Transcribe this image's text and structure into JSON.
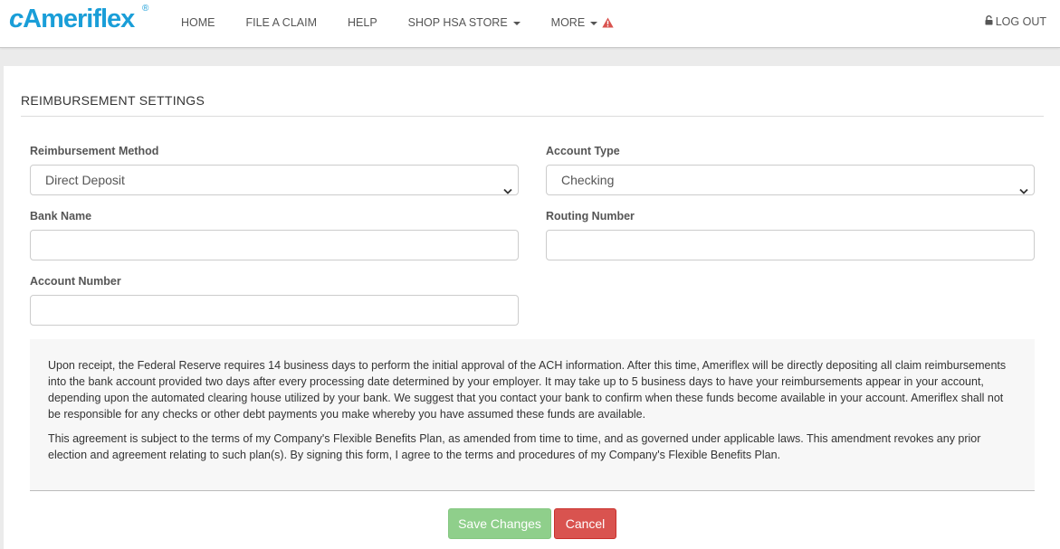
{
  "brand": {
    "name_prefix": "c",
    "name_rest": "Ameriflex",
    "registered": "®",
    "color": "#1a9ed8"
  },
  "nav": {
    "items": [
      {
        "label": "HOME"
      },
      {
        "label": "FILE A CLAIM"
      },
      {
        "label": "HELP"
      },
      {
        "label": "SHOP HSA STORE",
        "dropdown": true
      },
      {
        "label": "MORE",
        "dropdown": true,
        "alert": true
      }
    ],
    "logout_label": "LOG OUT"
  },
  "section": {
    "title": "REIMBURSEMENT SETTINGS"
  },
  "form": {
    "reimbursement_method": {
      "label": "Reimbursement Method",
      "value": "Direct Deposit"
    },
    "account_type": {
      "label": "Account Type",
      "value": "Checking"
    },
    "bank_name": {
      "label": "Bank Name",
      "value": "",
      "placeholder": ""
    },
    "routing_number": {
      "label": "Routing Number",
      "value": "",
      "placeholder": ""
    },
    "account_number": {
      "label": "Account Number",
      "value": "",
      "placeholder": ""
    }
  },
  "notice": {
    "paragraph1": "Upon receipt, the Federal Reserve requires 14 business days to perform the initial approval of the ACH information. After this time, Ameriflex will be directly depositing all claim reimbursements into the bank account provided two days after every processing date determined by your employer. It may take up to 5 business days to have your reimbursements appear in your account, depending upon the automated clearing house utilized by your bank. We suggest that you contact your bank to confirm when these funds become available in your account. Ameriflex shall not be responsible for any checks or other debt payments you make whereby you have assumed these funds are available.",
    "paragraph2": "This agreement is subject to the terms of my Company's Flexible Benefits Plan, as amended from time to time, and as governed under applicable laws. This amendment revokes any prior election and agreement relating to such plan(s). By signing this form, I agree to the terms and procedures of my Company's Flexible Benefits Plan."
  },
  "actions": {
    "save_label": "Save Changes",
    "cancel_label": "Cancel"
  },
  "colors": {
    "save": "#8fcf8b",
    "cancel": "#d9534f",
    "alert": "#d9534f"
  }
}
